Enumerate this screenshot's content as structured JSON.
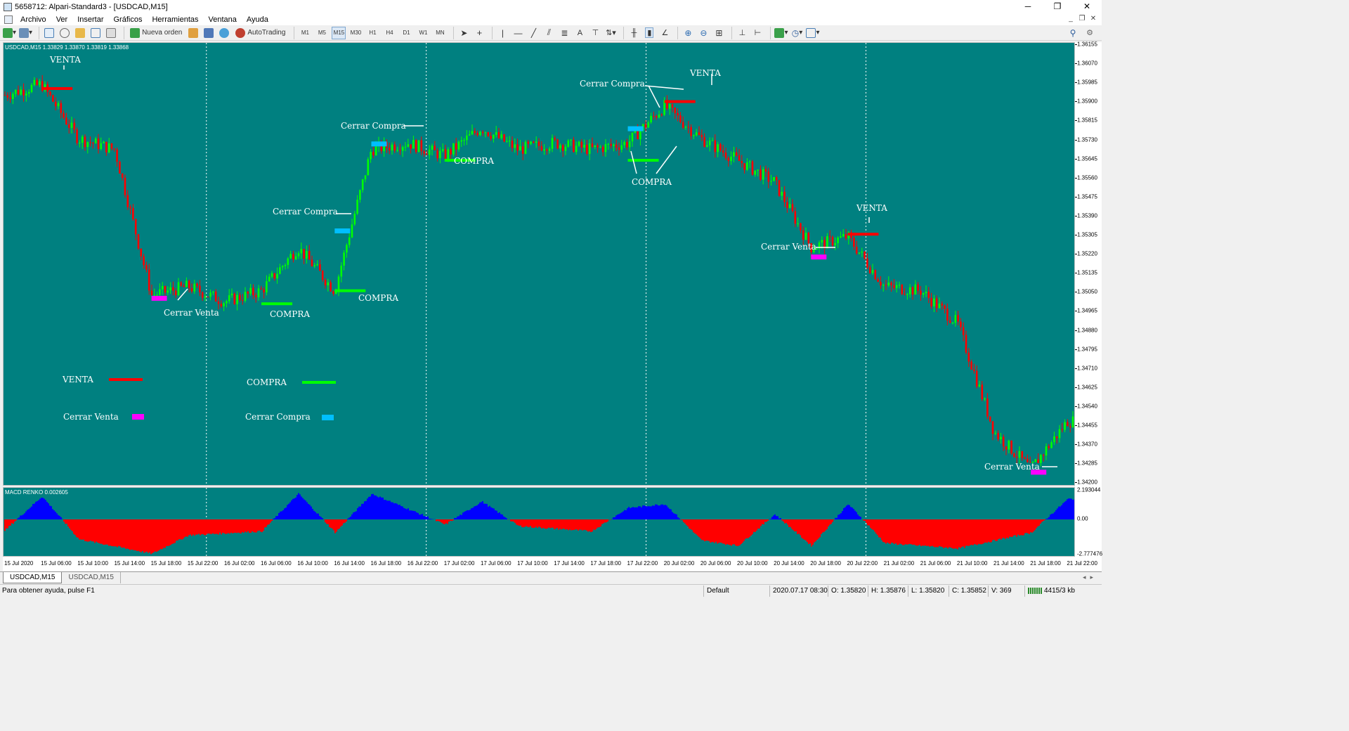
{
  "window": {
    "title": "5658712: Alpari-Standard3 - [USDCAD,M15]",
    "minimize": "─",
    "restore": "❐",
    "close": "✕"
  },
  "menu": [
    "Archivo",
    "Ver",
    "Insertar",
    "Gráficos",
    "Herramientas",
    "Ventana",
    "Ayuda"
  ],
  "toolbar": {
    "new_order": "Nueva orden",
    "autotrading": "AutoTrading",
    "timeframes": [
      "M1",
      "M5",
      "M15",
      "M30",
      "H1",
      "H4",
      "D1",
      "W1",
      "MN"
    ],
    "active_timeframe": "M15"
  },
  "chart": {
    "symbol_header": "USDCAD,M15  1.33829 1.33870 1.33819 1.33868",
    "indicator_label": "MACD RENKO 0.002605",
    "colors": {
      "background": "#008080",
      "bull": "#00ff00",
      "bear": "#ff0000",
      "venta": "#ff0000",
      "compra": "#00ff00",
      "cerrar_venta": "#ff00ff",
      "cerrar_compra": "#00bfff",
      "macd_positive": "#0000ff",
      "macd_negative": "#ff0000"
    },
    "price_labels": [
      "1.36155",
      "1.36070",
      "1.35985",
      "1.35900",
      "1.35815",
      "1.35730",
      "1.35645",
      "1.35560",
      "1.35475",
      "1.35390",
      "1.35305",
      "1.35220",
      "1.35135",
      "1.35050",
      "1.34965",
      "1.34880",
      "1.34795",
      "1.34710",
      "1.34625",
      "1.34540",
      "1.34455",
      "1.34370",
      "1.34285",
      "1.34200"
    ],
    "macd_axis": {
      "top": "2.193044",
      "zero": "0.00",
      "bottom": "-2.777476"
    },
    "time_labels": [
      "15 Jul 2020",
      "15 Jul 06:00",
      "15 Jul 10:00",
      "15 Jul 14:00",
      "15 Jul 18:00",
      "15 Jul 22:00",
      "16 Jul 02:00",
      "16 Jul 06:00",
      "16 Jul 10:00",
      "16 Jul 14:00",
      "16 Jul 18:00",
      "16 Jul 22:00",
      "17 Jul 02:00",
      "17 Jul 06:00",
      "17 Jul 10:00",
      "17 Jul 14:00",
      "17 Jul 18:00",
      "17 Jul 22:00",
      "20 Jul 02:00",
      "20 Jul 06:00",
      "20 Jul 10:00",
      "20 Jul 14:00",
      "20 Jul 18:00",
      "20 Jul 22:00",
      "21 Jul 02:00",
      "21 Jul 06:00",
      "21 Jul 10:00",
      "21 Jul 14:00",
      "21 Jul 18:00",
      "21 Jul 22:00"
    ],
    "annotations": {
      "venta_1": "VENTA",
      "cerrar_venta_1": "Cerrar Venta",
      "compra_1": "COMPRA",
      "cerrar_compra_1": "Cerrar Compra",
      "compra_2": "COMPRA",
      "cerrar_compra_2": "Cerrar Compra",
      "compra_3": "COMPRA",
      "cerrar_compra_3": "Cerrar Compra",
      "venta_2": "VENTA",
      "compra_4": "COMPRA",
      "venta_3": "VENTA",
      "cerrar_venta_2": "Cerrar Venta",
      "cerrar_venta_3": "Cerrar Venta"
    },
    "legend": {
      "venta": "VENTA",
      "compra": "COMPRA",
      "cerrar_venta": "Cerrar Venta",
      "cerrar_compra": "Cerrar Compra"
    }
  },
  "tabs": [
    "USDCAD,M15",
    "USDCAD,M15"
  ],
  "status": {
    "help": "Para obtener ayuda, pulse F1",
    "profile": "Default",
    "datetime": "2020.07.17 08:30",
    "open": "O: 1.35820",
    "high": "H: 1.35876",
    "low": "L: 1.35820",
    "close": "C: 1.35852",
    "volume": "V: 369",
    "traffic": "4415/3 kb"
  },
  "chart_data": {
    "type": "candlestick",
    "symbol": "USDCAD",
    "timeframe": "M15",
    "ylim": [
      1.342,
      1.3624
    ],
    "close_path_keypoints": [
      {
        "x": "15 Jul 2020",
        "y": 1.36
      },
      {
        "x": "15 Jul 06:00",
        "y": 1.3605
      },
      {
        "x": "15 Jul 10:00",
        "y": 1.358
      },
      {
        "x": "15 Jul 14:00",
        "y": 1.3575
      },
      {
        "x": "15 Jul 18:00",
        "y": 1.3508
      },
      {
        "x": "15 Jul 22:00",
        "y": 1.3512
      },
      {
        "x": "16 Jul 02:00",
        "y": 1.3505
      },
      {
        "x": "16 Jul 06:00",
        "y": 1.351
      },
      {
        "x": "16 Jul 10:00",
        "y": 1.353
      },
      {
        "x": "16 Jul 14:00",
        "y": 1.351
      },
      {
        "x": "16 Jul 18:00",
        "y": 1.3575
      },
      {
        "x": "16 Jul 22:00",
        "y": 1.3578
      },
      {
        "x": "17 Jul 02:00",
        "y": 1.3572
      },
      {
        "x": "17 Jul 06:00",
        "y": 1.3585
      },
      {
        "x": "17 Jul 10:00",
        "y": 1.3575
      },
      {
        "x": "17 Jul 14:00",
        "y": 1.3578
      },
      {
        "x": "17 Jul 18:00",
        "y": 1.3575
      },
      {
        "x": "17 Jul 22:00",
        "y": 1.3578
      },
      {
        "x": "20 Jul 02:00",
        "y": 1.3595
      },
      {
        "x": "20 Jul 06:00",
        "y": 1.358
      },
      {
        "x": "20 Jul 10:00",
        "y": 1.357
      },
      {
        "x": "20 Jul 14:00",
        "y": 1.356
      },
      {
        "x": "20 Jul 18:00",
        "y": 1.353
      },
      {
        "x": "20 Jul 22:00",
        "y": 1.3535
      },
      {
        "x": "21 Jul 02:00",
        "y": 1.3512
      },
      {
        "x": "21 Jul 06:00",
        "y": 1.351
      },
      {
        "x": "21 Jul 10:00",
        "y": 1.3495
      },
      {
        "x": "21 Jul 14:00",
        "y": 1.3445
      },
      {
        "x": "21 Jul 18:00",
        "y": 1.3428
      },
      {
        "x": "21 Jul 22:00",
        "y": 1.345
      }
    ],
    "signals": [
      {
        "label": "VENTA",
        "x": "15 Jul 06:00",
        "y": 1.3603
      },
      {
        "label": "Cerrar Venta",
        "x": "15 Jul 18:00",
        "y": 1.3507
      },
      {
        "label": "COMPRA",
        "x": "16 Jul 06:00",
        "y": 1.3504
      },
      {
        "label": "Cerrar Compra",
        "x": "16 Jul 14:00",
        "y": 1.3538
      },
      {
        "label": "COMPRA",
        "x": "16 Jul 14:00",
        "y": 1.351
      },
      {
        "label": "Cerrar Compra",
        "x": "16 Jul 18:00",
        "y": 1.3578
      },
      {
        "label": "COMPRA",
        "x": "17 Jul 02:00",
        "y": 1.357
      },
      {
        "label": "Cerrar Compra",
        "x": "17 Jul 22:00",
        "y": 1.3585
      },
      {
        "label": "COMPRA",
        "x": "17 Jul 22:00",
        "y": 1.357
      },
      {
        "label": "VENTA",
        "x": "20 Jul 02:00",
        "y": 1.3597
      },
      {
        "label": "VENTA",
        "x": "20 Jul 22:00",
        "y": 1.3536
      },
      {
        "label": "Cerrar Venta",
        "x": "20 Jul 18:00",
        "y": 1.3526
      },
      {
        "label": "Cerrar Venta",
        "x": "21 Jul 18:00",
        "y": 1.3427
      }
    ],
    "macd": {
      "name": "MACD RENKO",
      "ylim": [
        -2.777476,
        2.193044
      ],
      "keypoints": [
        {
          "x": "15 Jul 2020",
          "y": -0.8
        },
        {
          "x": "15 Jul 06:00",
          "y": 1.8
        },
        {
          "x": "15 Jul 10:00",
          "y": -1.5
        },
        {
          "x": "15 Jul 18:00",
          "y": -2.6
        },
        {
          "x": "15 Jul 22:00",
          "y": -1.2
        },
        {
          "x": "16 Jul 06:00",
          "y": -0.9
        },
        {
          "x": "16 Jul 10:00",
          "y": 2.0
        },
        {
          "x": "16 Jul 14:00",
          "y": -1.0
        },
        {
          "x": "16 Jul 18:00",
          "y": 2.0
        },
        {
          "x": "16 Jul 22:00",
          "y": 0.8
        },
        {
          "x": "17 Jul 02:00",
          "y": -0.4
        },
        {
          "x": "17 Jul 06:00",
          "y": 1.4
        },
        {
          "x": "17 Jul 10:00",
          "y": -0.5
        },
        {
          "x": "17 Jul 18:00",
          "y": -0.9
        },
        {
          "x": "17 Jul 22:00",
          "y": 0.9
        },
        {
          "x": "20 Jul 02:00",
          "y": 1.2
        },
        {
          "x": "20 Jul 06:00",
          "y": -1.6
        },
        {
          "x": "20 Jul 10:00",
          "y": -2.0
        },
        {
          "x": "20 Jul 14:00",
          "y": 0.4
        },
        {
          "x": "20 Jul 18:00",
          "y": -2.0
        },
        {
          "x": "20 Jul 22:00",
          "y": 1.2
        },
        {
          "x": "21 Jul 02:00",
          "y": -1.8
        },
        {
          "x": "21 Jul 10:00",
          "y": -2.2
        },
        {
          "x": "21 Jul 18:00",
          "y": -1.0
        },
        {
          "x": "21 Jul 22:00",
          "y": 1.6
        }
      ]
    }
  }
}
